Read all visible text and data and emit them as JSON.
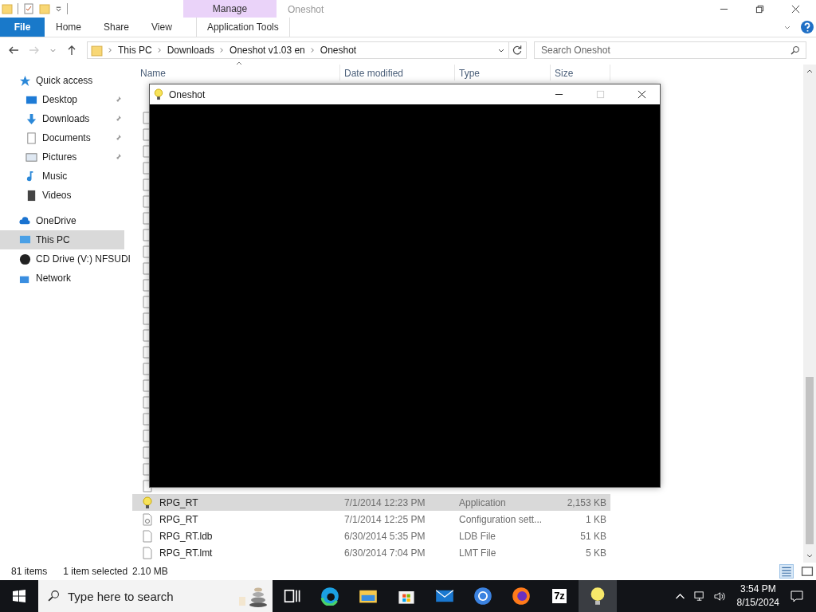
{
  "explorer": {
    "title": "Oneshot",
    "contextual_tab": "Manage",
    "ribbon_tabs": [
      {
        "label": "File",
        "kind": "file"
      },
      {
        "label": "Home",
        "kind": "tab"
      },
      {
        "label": "Share",
        "kind": "tab"
      },
      {
        "label": "View",
        "kind": "tab"
      },
      {
        "label": "Application Tools",
        "kind": "contextual"
      }
    ],
    "breadcrumb": [
      "This PC",
      "Downloads",
      "Oneshot v1.03 en",
      "Oneshot"
    ],
    "search": {
      "placeholder": "Search Oneshot"
    },
    "nav": [
      {
        "label": "Quick access",
        "kind": "star",
        "selected": false,
        "children": [
          {
            "label": "Desktop",
            "kind": "desktop",
            "pinned": true,
            "selected": false
          },
          {
            "label": "Downloads",
            "kind": "download",
            "pinned": true,
            "selected": false
          },
          {
            "label": "Documents",
            "kind": "document",
            "pinned": true,
            "selected": false
          },
          {
            "label": "Pictures",
            "kind": "picture",
            "pinned": true,
            "selected": false
          },
          {
            "label": "Music",
            "kind": "music",
            "pinned": false,
            "selected": false
          },
          {
            "label": "Videos",
            "kind": "video",
            "pinned": false,
            "selected": false
          }
        ]
      },
      {
        "label": "OneDrive",
        "kind": "cloud",
        "selected": false
      },
      {
        "label": "This PC",
        "kind": "pc",
        "selected": true
      },
      {
        "label": "CD Drive (V:) NFSUDI",
        "kind": "disc",
        "selected": false
      },
      {
        "label": "Network",
        "kind": "network",
        "selected": false
      }
    ],
    "columns": [
      "Name",
      "Date modified",
      "Type",
      "Size"
    ],
    "files": [
      {
        "name": "RPG_RT",
        "date": "7/1/2014 12:23 PM",
        "type": "Application",
        "size": "2,153 KB",
        "kind": "app",
        "selected": true
      },
      {
        "name": "RPG_RT",
        "date": "7/1/2014 12:25 PM",
        "type": "Configuration sett...",
        "size": "1 KB",
        "kind": "config",
        "selected": false
      },
      {
        "name": "RPG_RT.ldb",
        "date": "6/30/2014 5:35 PM",
        "type": "LDB File",
        "size": "51 KB",
        "kind": "file",
        "selected": false
      },
      {
        "name": "RPG_RT.lmt",
        "date": "6/30/2014 7:04 PM",
        "type": "LMT File",
        "size": "5 KB",
        "kind": "file",
        "selected": false
      }
    ],
    "status": {
      "count": "81 items",
      "selection": "1 item selected",
      "selection_size": "2.10 MB"
    }
  },
  "game_window": {
    "title": "Oneshot"
  },
  "taskbar": {
    "search_placeholder": "Type here to search",
    "apps": [
      {
        "kind": "taskview",
        "active": false
      },
      {
        "kind": "edge",
        "active": false
      },
      {
        "kind": "folder",
        "active": false
      },
      {
        "kind": "store",
        "active": false
      },
      {
        "kind": "mail",
        "active": false
      },
      {
        "kind": "chrome",
        "active": false
      },
      {
        "kind": "firefox",
        "active": false
      },
      {
        "kind": "archiver",
        "label": "7z",
        "active": false
      },
      {
        "kind": "bulb",
        "active": true
      }
    ],
    "time": "3:54 PM",
    "date": "8/15/2024"
  }
}
